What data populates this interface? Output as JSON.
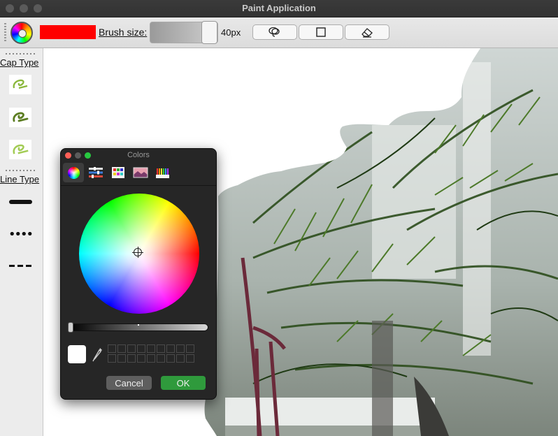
{
  "window": {
    "title": "Paint Application"
  },
  "toolbar": {
    "color_icon": "color-wheel-icon",
    "current_color": "#ff0000",
    "brush_label": "Brush size:",
    "brush_value": "40px",
    "brush_level": 1.0,
    "tools": [
      {
        "icon": "lasso-icon"
      },
      {
        "icon": "rectangle-icon"
      },
      {
        "icon": "eraser-icon"
      }
    ]
  },
  "sidebar": {
    "cap_title": "Cap Type",
    "caps": [
      {
        "icon": "butt-cap-icon"
      },
      {
        "icon": "round-cap-icon"
      },
      {
        "icon": "square-cap-icon"
      }
    ],
    "line_title": "Line Type",
    "lines": [
      {
        "icon": "solid-line-icon"
      },
      {
        "icon": "dotted-line-icon"
      },
      {
        "icon": "dashed-line-icon"
      }
    ]
  },
  "color_panel": {
    "title": "Colors",
    "tabs": [
      {
        "icon": "color-wheel-tab-icon"
      },
      {
        "icon": "sliders-tab-icon"
      },
      {
        "icon": "palettes-tab-icon"
      },
      {
        "icon": "image-palettes-tab-icon"
      },
      {
        "icon": "pencils-tab-icon"
      }
    ],
    "selected_color": "#ffffff",
    "cancel_label": "Cancel",
    "ok_label": "OK",
    "colors": {
      "ok": "#2f9a3c",
      "cancel": "#5e5e5e"
    }
  }
}
